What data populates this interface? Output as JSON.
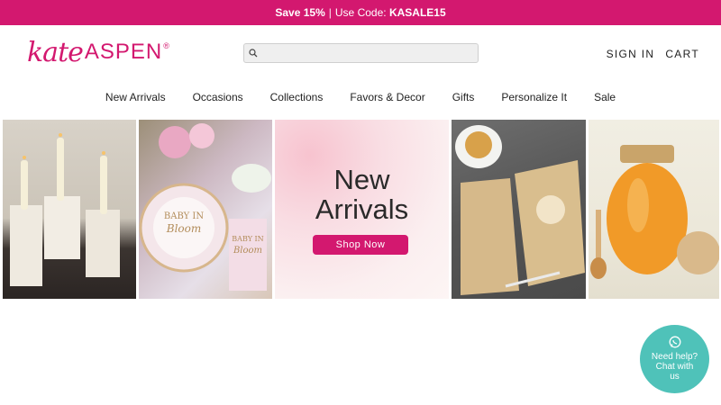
{
  "promo": {
    "prefix": "Save 15%",
    "separator": "|",
    "text": "Use Code:",
    "code": "KASALE15"
  },
  "brand": {
    "logo_script": "kate",
    "logo_caps": "ASPEN",
    "logo_mark": "®",
    "accent": "#d3186f"
  },
  "search": {
    "placeholder": "",
    "value": ""
  },
  "account": {
    "sign_in": "SIGN IN",
    "cart": "CART"
  },
  "nav": {
    "items": [
      {
        "label": "New Arrivals"
      },
      {
        "label": "Occasions"
      },
      {
        "label": "Collections"
      },
      {
        "label": "Favors & Decor"
      },
      {
        "label": "Gifts"
      },
      {
        "label": "Personalize It"
      },
      {
        "label": "Sale"
      }
    ]
  },
  "hero": {
    "title_line1": "New",
    "title_line2": "Arrivals",
    "cta": "Shop Now",
    "images": [
      "candles-on-pillars",
      "baby-in-bloom-plates",
      "pink-watercolor",
      "honey-bee-cards",
      "honey-jar"
    ]
  },
  "chat": {
    "line1": "Need help?",
    "line2": "Chat with",
    "line3": "us",
    "color": "#4fc2b9"
  }
}
